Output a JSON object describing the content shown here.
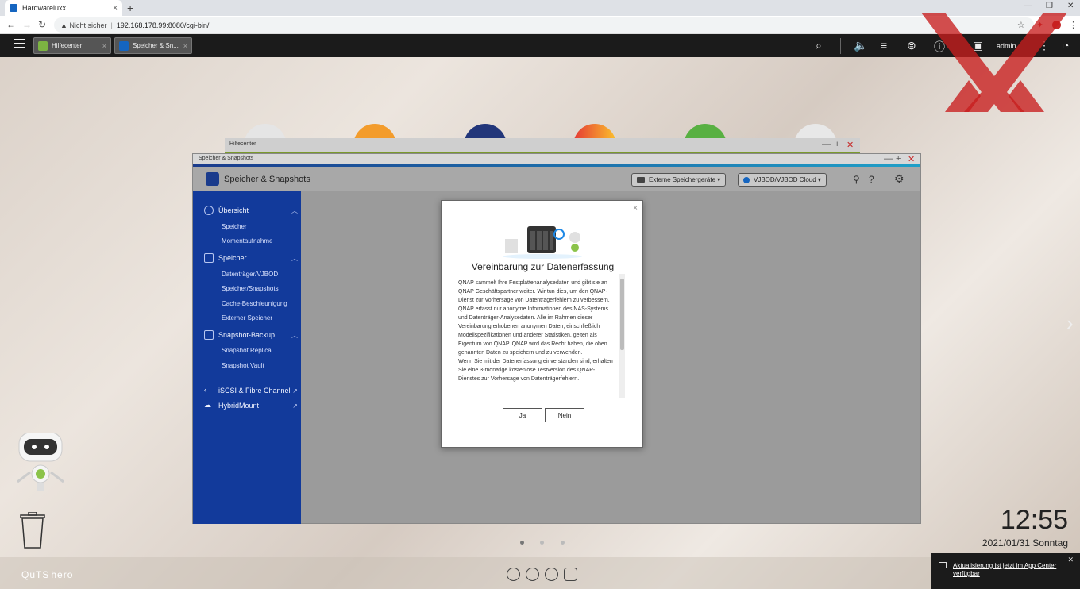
{
  "browser": {
    "tab_title": "Hardwareluxx",
    "tab_close": "×",
    "new_tab": "+",
    "security_label": "Nicht sicher",
    "url": "192.168.178.99:8080/cgi-bin/"
  },
  "qnap_bar": {
    "tabs": [
      {
        "label": "Hilfecenter",
        "color": "#7cb342"
      },
      {
        "label": "Speicher & Sn...",
        "color": "#1565c0"
      }
    ],
    "user": "admin"
  },
  "help_window": {
    "title": "Hilfecenter"
  },
  "storage_window": {
    "title": "Speicher & Snapshots",
    "app_title": "Speicher & Snapshots",
    "external_devices": "Externe Speichergeräte",
    "cloud": "VJBOD/VJBOD Cloud",
    "sidebar": {
      "overview": "Übersicht",
      "overview_items": [
        "Speicher",
        "Momentaufnahme"
      ],
      "storage": "Speicher",
      "storage_items": [
        "Datenträger/VJBOD",
        "Speicher/Snapshots",
        "Cache-Beschleunigung",
        "Externer Speicher"
      ],
      "snapshot_backup": "Snapshot-Backup",
      "snapshot_items": [
        "Snapshot Replica",
        "Snapshot Vault"
      ],
      "iscsi": "iSCSI & Fibre Channel",
      "hybridmount": "HybridMount"
    }
  },
  "dialog": {
    "title": "Vereinbarung zur Datenerfassung",
    "paragraphs": [
      "QNAP sammelt Ihre Festplattenanalysedaten und gibt sie an QNAP Geschäftspartner weiter. Wir tun dies, um den QNAP-Dienst zur Vorhersage von Datenträgerfehlern zu verbessern.",
      "QNAP erfasst nur anonyme Informationen des NAS-Systems und Datenträger-Analysedaten. Alle im Rahmen dieser Vereinbarung erhobenen anonymen Daten, einschließlich Modellspezifikationen und anderer Statistiken, gelten als Eigentum von QNAP. QNAP wird das Recht haben, die oben genannten Daten zu speichern und zu verwenden.",
      "Wenn Sie mit der Datenerfassung einverstanden sind, erhalten Sie eine 3-monatige kostenlose Testversion des QNAP-Dienstes zur Vorhersage von Datenträgerfehlern."
    ],
    "yes": "Ja",
    "no": "Nein",
    "close": "×"
  },
  "desktop": {
    "time": "12:55",
    "date": "2021/01/31 Sonntag",
    "brand": "QuTS",
    "brand_suffix": "hero",
    "notification": "Aktualisierung ist jetzt im App Center verfügbar"
  }
}
